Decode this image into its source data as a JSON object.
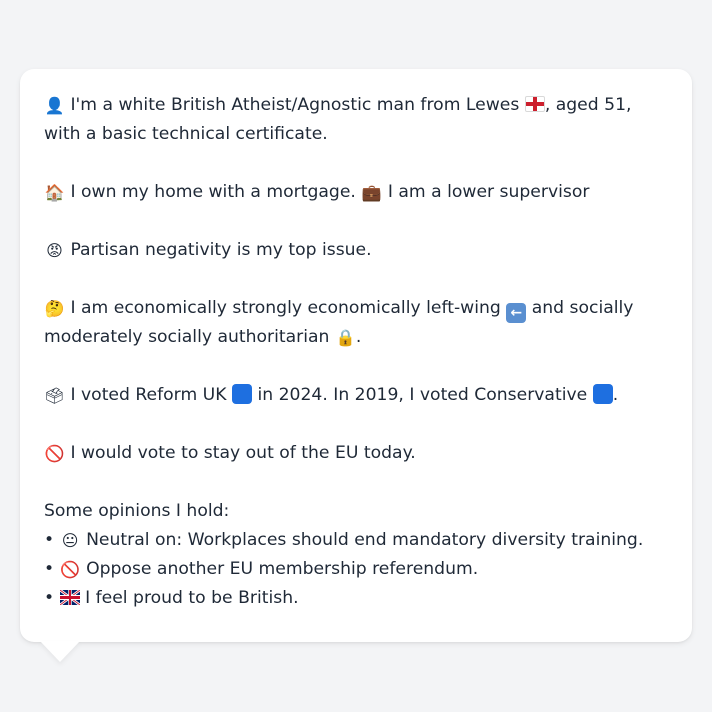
{
  "profile": {
    "identity": {
      "icon": "person-silhouette-icon",
      "text_before_flag": "I'm a white British Atheist/Agnostic man from Lewes",
      "flag": "england-flag-icon",
      "text_after_flag": ", aged 51, with a basic technical certificate."
    },
    "home": {
      "icon": "house-icon",
      "text_1": "I own my home with a mortgage.",
      "icon_2": "briefcase-icon",
      "text_2": "I am a lower supervisor"
    },
    "issue": {
      "icon": "angry-face-icon",
      "text": "Partisan negativity is my top issue."
    },
    "politics": {
      "icon": "thinking-face-icon",
      "text_1": "I am economically strongly economically left-wing",
      "icon_2": "left-arrow-icon",
      "text_2": "and socially moderately socially authoritarian",
      "icon_3": "lock-icon",
      "text_3": "."
    },
    "votes": {
      "icon": "ballot-box-icon",
      "text_1": "I voted Reform UK",
      "reform_color": "#1e6fe0",
      "text_2": "in 2024. In 2019, I voted Conservative",
      "conservative_color": "#1e6fe0",
      "text_3": "."
    },
    "eu": {
      "icon": "prohibited-icon",
      "text": "I would vote to stay out of the EU today."
    },
    "opinions": {
      "heading": "Some opinions I hold:",
      "bullet": "•",
      "items": [
        {
          "icon": "neutral-face-icon",
          "text": "Neutral on: Workplaces should end mandatory diversity training."
        },
        {
          "icon": "prohibited-icon",
          "text": "Oppose another EU membership referendum."
        },
        {
          "icon": "uk-flag-icon",
          "text": "I feel proud to be British."
        }
      ]
    }
  }
}
